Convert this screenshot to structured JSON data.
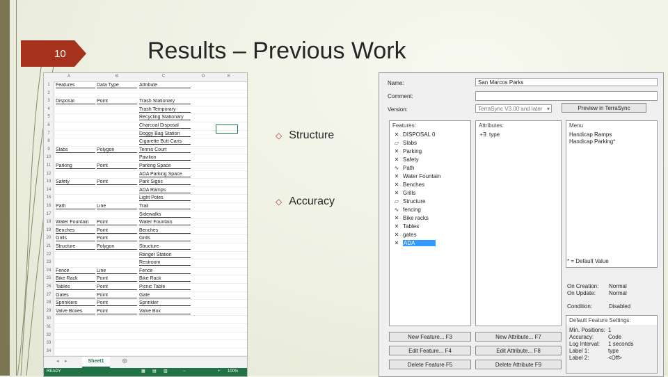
{
  "slide": {
    "number": "10",
    "title": "Results – Previous Work",
    "bullets": [
      "Structure",
      "Accuracy"
    ]
  },
  "excel": {
    "columns": [
      "A",
      "B",
      "C",
      "D",
      "E"
    ],
    "header": [
      "Features",
      "Data Type",
      "Attribute"
    ],
    "rows": [
      {
        "n": "1",
        "a": "Features",
        "b": "Data Type",
        "c": "Attribute"
      },
      {
        "n": "2",
        "a": "",
        "b": "",
        "c": ""
      },
      {
        "n": "3",
        "a": "Disposal",
        "b": "Point",
        "c": "Trash Stationary"
      },
      {
        "n": "4",
        "a": "",
        "b": "",
        "c": "Trash Temporary"
      },
      {
        "n": "5",
        "a": "",
        "b": "",
        "c": "Recycling Stationary"
      },
      {
        "n": "6",
        "a": "",
        "b": "",
        "c": "Charcoal Disposal"
      },
      {
        "n": "7",
        "a": "",
        "b": "",
        "c": "Doggy Bag Station"
      },
      {
        "n": "8",
        "a": "",
        "b": "",
        "c": "Cigarette Butt Cans"
      },
      {
        "n": "9",
        "a": "Slabs",
        "b": "Polygon",
        "c": "Tennis Court"
      },
      {
        "n": "10",
        "a": "",
        "b": "",
        "c": "Pavilion"
      },
      {
        "n": "11",
        "a": "Parking",
        "b": "Point",
        "c": "Parking Space"
      },
      {
        "n": "12",
        "a": "",
        "b": "",
        "c": "ADA Parking Space"
      },
      {
        "n": "13",
        "a": "Safety",
        "b": "Point",
        "c": "Park Signs"
      },
      {
        "n": "14",
        "a": "",
        "b": "",
        "c": "ADA Ramps"
      },
      {
        "n": "15",
        "a": "",
        "b": "",
        "c": "Light Poles"
      },
      {
        "n": "16",
        "a": "Path",
        "b": "Line",
        "c": "Trail"
      },
      {
        "n": "17",
        "a": "",
        "b": "",
        "c": "Sidewalks"
      },
      {
        "n": "18",
        "a": "Water Fountain",
        "b": "Point",
        "c": "Water Fountain"
      },
      {
        "n": "19",
        "a": "Benches",
        "b": "Point",
        "c": "Benches"
      },
      {
        "n": "20",
        "a": "Grills",
        "b": "Point",
        "c": "Grills"
      },
      {
        "n": "21",
        "a": "Structure",
        "b": "Polygon",
        "c": "Structure"
      },
      {
        "n": "22",
        "a": "",
        "b": "",
        "c": "Ranger Station"
      },
      {
        "n": "23",
        "a": "",
        "b": "",
        "c": "Restroom"
      },
      {
        "n": "24",
        "a": "Fence",
        "b": "Line",
        "c": "Fence"
      },
      {
        "n": "25",
        "a": "Bike Rack",
        "b": "Point",
        "c": "Bike Rack"
      },
      {
        "n": "26",
        "a": "Tables",
        "b": "Point",
        "c": "Picnic Table"
      },
      {
        "n": "27",
        "a": "Gates",
        "b": "Point",
        "c": "Gate"
      },
      {
        "n": "28",
        "a": "Sprinklers",
        "b": "Point",
        "c": "Sprinkler"
      },
      {
        "n": "29",
        "a": "Valve Boxes",
        "b": "Point",
        "c": "Valve Box"
      },
      {
        "n": "30",
        "a": "",
        "b": "",
        "c": ""
      },
      {
        "n": "31",
        "a": "",
        "b": "",
        "c": ""
      },
      {
        "n": "32",
        "a": "",
        "b": "",
        "c": ""
      },
      {
        "n": "33",
        "a": "",
        "b": "",
        "c": ""
      },
      {
        "n": "34",
        "a": "",
        "b": "",
        "c": ""
      }
    ],
    "sheet_tab": "Sheet1",
    "status_left": "READY",
    "zoom": "100%"
  },
  "dialog": {
    "name_label": "Name:",
    "name_value": "San Marcos Parks",
    "comment_label": "Comment:",
    "comment_value": "",
    "version_label": "Version:",
    "version_value": "TerraSync V3.00 and later",
    "preview_button": "Preview in TerraSync",
    "features_header": "Features:",
    "features": [
      {
        "icon": "x",
        "label": "DISPOSAL 0"
      },
      {
        "icon": "poly",
        "label": "Slabs"
      },
      {
        "icon": "x",
        "label": "Parking"
      },
      {
        "icon": "x",
        "label": "Safety"
      },
      {
        "icon": "line",
        "label": "Path"
      },
      {
        "icon": "x",
        "label": "Water Fountain"
      },
      {
        "icon": "x",
        "label": "Benches"
      },
      {
        "icon": "x",
        "label": "Grills"
      },
      {
        "icon": "poly",
        "label": "Structure"
      },
      {
        "icon": "line",
        "label": "fencing"
      },
      {
        "icon": "x",
        "label": "Bike racks"
      },
      {
        "icon": "x",
        "label": "Tables"
      },
      {
        "icon": "x",
        "label": "gates"
      },
      {
        "icon": "x",
        "label": "ADA"
      }
    ],
    "attributes_header": "Attributes:",
    "attributes": [
      {
        "icon": "+∃",
        "label": "type"
      }
    ],
    "menu_header": "Menu",
    "menu_items": [
      "Handicap Ramps",
      "Handicap Parking*"
    ],
    "default_value_note": "* = Default Value",
    "on_creation_label": "On Creation:",
    "on_creation_value": "Normal",
    "on_update_label": "On Update:",
    "on_update_value": "Normal",
    "condition_label": "Condition:",
    "condition_value": "Disabled",
    "default_settings_header": "Default Feature Settings:",
    "default_settings": [
      {
        "k": "Min. Positions:",
        "v": "1"
      },
      {
        "k": "Accuracy:",
        "v": "Code"
      },
      {
        "k": "Log Interval:",
        "v": "1 seconds"
      },
      {
        "k": "Label 1:",
        "v": "type"
      },
      {
        "k": "Label 2:",
        "v": "<Off>"
      }
    ],
    "buttons": {
      "new_feature": "New Feature... F3",
      "edit_feature": "Edit Feature... F4",
      "delete_feature": "Delete Feature F5",
      "new_attribute": "New Attribute... F7",
      "edit_attribute": "Edit Attribute... F8",
      "delete_attribute": "Delete Attribute F9"
    }
  }
}
